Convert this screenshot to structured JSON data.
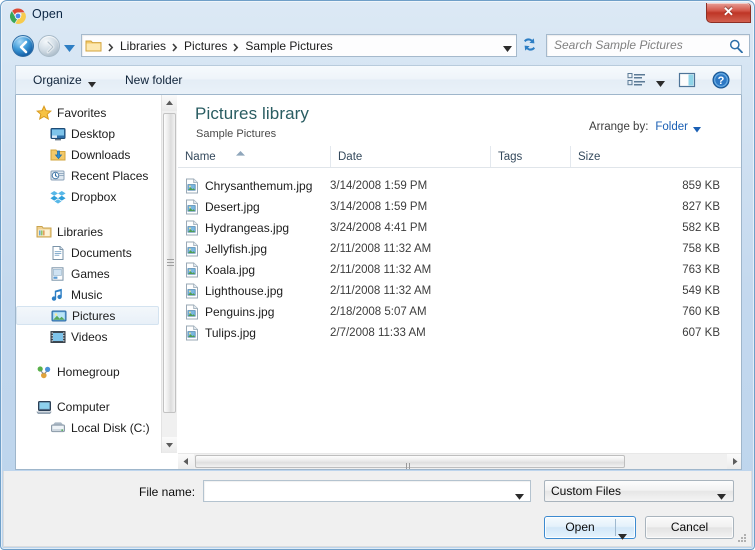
{
  "window": {
    "title": "Open",
    "title_icon": "chrome-logo-icon",
    "close_label": "✕"
  },
  "address_bar": {
    "back_icon": "back-arrow-icon",
    "forward_icon": "forward-arrow-icon",
    "recent_icon": "recent-locations-chevron-icon",
    "folder_icon": "folder-icon",
    "crumbs": [
      "Libraries",
      "Pictures",
      "Sample Pictures"
    ],
    "dropdown_icon": "chevron-down-icon",
    "refresh_icon": "refresh-icon"
  },
  "search": {
    "placeholder": "Search Sample Pictures",
    "icon": "search-icon"
  },
  "toolbar": {
    "organize_label": "Organize",
    "organize_caret": "chevron-down-icon",
    "new_folder_label": "New folder",
    "view_icon": "list-view-icon",
    "view_caret": "chevron-down-icon",
    "preview_pane_icon": "preview-pane-icon",
    "help_icon": "help-icon"
  },
  "sidebar": {
    "items": [
      {
        "label": "Favorites",
        "icon": "star-icon",
        "level": "root",
        "selected": false
      },
      {
        "label": "Desktop",
        "icon": "desktop-icon",
        "level": "child",
        "selected": false
      },
      {
        "label": "Downloads",
        "icon": "downloads-icon",
        "level": "child",
        "selected": false
      },
      {
        "label": "Recent Places",
        "icon": "recent-places-icon",
        "level": "child",
        "selected": false
      },
      {
        "label": "Dropbox",
        "icon": "dropbox-icon",
        "level": "child",
        "selected": false
      },
      {
        "label": "Libraries",
        "icon": "libraries-icon",
        "level": "root",
        "selected": false
      },
      {
        "label": "Documents",
        "icon": "documents-icon",
        "level": "child",
        "selected": false
      },
      {
        "label": "Games",
        "icon": "games-icon",
        "level": "child",
        "selected": false
      },
      {
        "label": "Music",
        "icon": "music-icon",
        "level": "child",
        "selected": false
      },
      {
        "label": "Pictures",
        "icon": "pictures-icon",
        "level": "child",
        "selected": true
      },
      {
        "label": "Videos",
        "icon": "videos-icon",
        "level": "child",
        "selected": false
      },
      {
        "label": "Homegroup",
        "icon": "homegroup-icon",
        "level": "root",
        "selected": false
      },
      {
        "label": "Computer",
        "icon": "computer-icon",
        "level": "root",
        "selected": false
      },
      {
        "label": "Local Disk (C:)",
        "icon": "hard-drive-icon",
        "level": "child",
        "selected": false
      }
    ]
  },
  "content": {
    "library_title": "Pictures library",
    "library_subtitle": "Sample Pictures",
    "arrange_label": "Arrange by:",
    "arrange_value": "Folder",
    "arrange_caret": "chevron-down-icon",
    "columns": [
      {
        "label": "Name",
        "sorted": true,
        "sort_dir": "asc"
      },
      {
        "label": "Date",
        "sorted": false,
        "sort_dir": ""
      },
      {
        "label": "Tags",
        "sorted": false,
        "sort_dir": ""
      },
      {
        "label": "Size",
        "sorted": false,
        "sort_dir": ""
      }
    ],
    "files": [
      {
        "name": "Chrysanthemum.jpg",
        "date": "3/14/2008 1:59 PM",
        "tags": "",
        "size": "859 KB",
        "icon": "jpg-file-icon"
      },
      {
        "name": "Desert.jpg",
        "date": "3/14/2008 1:59 PM",
        "tags": "",
        "size": "827 KB",
        "icon": "jpg-file-icon"
      },
      {
        "name": "Hydrangeas.jpg",
        "date": "3/24/2008 4:41 PM",
        "tags": "",
        "size": "582 KB",
        "icon": "jpg-file-icon"
      },
      {
        "name": "Jellyfish.jpg",
        "date": "2/11/2008 11:32 AM",
        "tags": "",
        "size": "758 KB",
        "icon": "jpg-file-icon"
      },
      {
        "name": "Koala.jpg",
        "date": "2/11/2008 11:32 AM",
        "tags": "",
        "size": "763 KB",
        "icon": "jpg-file-icon"
      },
      {
        "name": "Lighthouse.jpg",
        "date": "2/11/2008 11:32 AM",
        "tags": "",
        "size": "549 KB",
        "icon": "jpg-file-icon"
      },
      {
        "name": "Penguins.jpg",
        "date": "2/18/2008 5:07 AM",
        "tags": "",
        "size": "760 KB",
        "icon": "jpg-file-icon"
      },
      {
        "name": "Tulips.jpg",
        "date": "2/7/2008 11:33 AM",
        "tags": "",
        "size": "607 KB",
        "icon": "jpg-file-icon"
      }
    ]
  },
  "footer": {
    "file_name_label": "File name:",
    "file_name_value": "",
    "file_name_placeholder": "",
    "file_type_value": "Custom Files",
    "open_label": "Open",
    "cancel_label": "Cancel",
    "resize_grip_icon": "resize-grip-icon"
  },
  "colors": {
    "accent": "#1a5fb4",
    "library_title": "#2a5d62",
    "close_button": "#bf3526",
    "frame": "#6f9fc8"
  }
}
